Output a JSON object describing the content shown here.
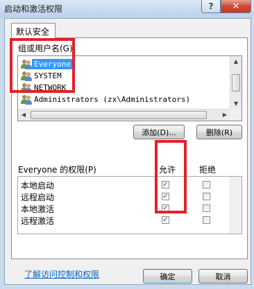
{
  "window": {
    "title": "启动和激活权限",
    "help_label": "?",
    "close_label": "✕"
  },
  "tabs": [
    {
      "label": "默认安全",
      "active": true
    }
  ],
  "users": {
    "label": "组或用户名(G):",
    "items": [
      {
        "name": "Everyone",
        "selected": true
      },
      {
        "name": "SYSTEM",
        "selected": false
      },
      {
        "name": "NETWORK",
        "selected": false
      },
      {
        "name": "Administrators (zx\\Administrators)",
        "selected": false
      }
    ]
  },
  "buttons": {
    "add": "添加(D)...",
    "remove": "删除(R)",
    "ok": "确定",
    "cancel": "取消"
  },
  "permissions": {
    "label": "Everyone 的权限(P)",
    "allow_header": "允许",
    "deny_header": "拒绝",
    "rows": [
      {
        "name": "本地启动",
        "allow": true,
        "deny": false
      },
      {
        "name": "远程启动",
        "allow": true,
        "deny": false
      },
      {
        "name": "本地激活",
        "allow": true,
        "deny": false
      },
      {
        "name": "远程激活",
        "allow": true,
        "deny": false
      }
    ]
  },
  "link": "了解访问控制和权限",
  "annotation_color": "#e32128"
}
